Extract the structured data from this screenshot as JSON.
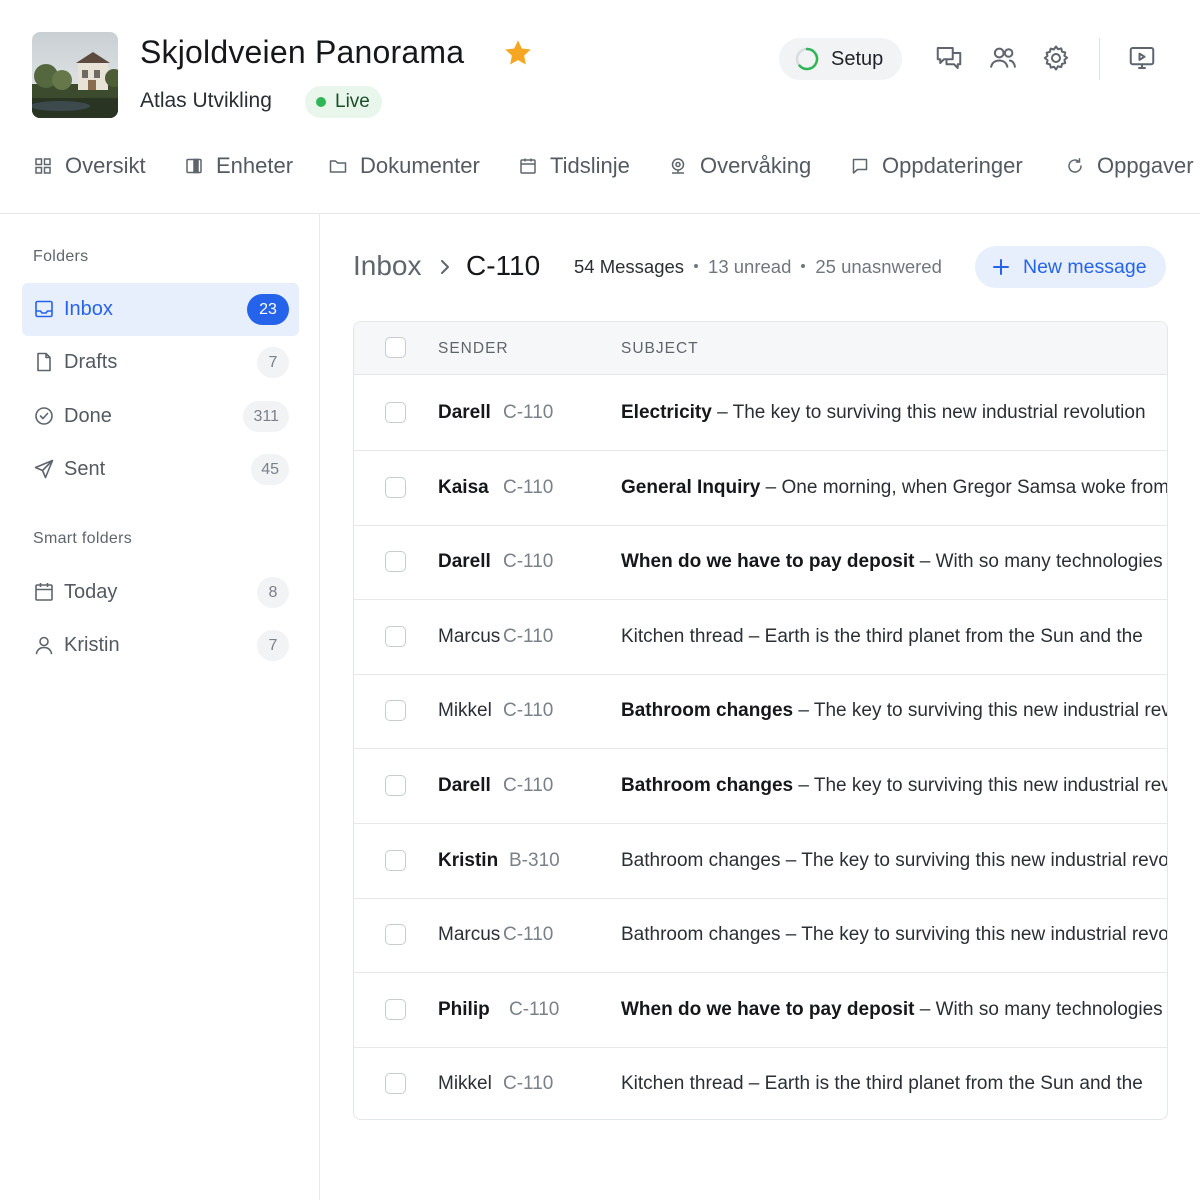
{
  "project": {
    "title": "Skjoldveien Panorama",
    "developer": "Atlas Utvikling",
    "status": "Live",
    "status_color": "#2fb757",
    "setup_label": "Setup"
  },
  "header_icons": [
    "chat-icon",
    "people-icon",
    "gear-icon",
    "presentation-icon"
  ],
  "tabs": [
    {
      "label": "Oversikt",
      "icon": "grid-icon"
    },
    {
      "label": "Enheter",
      "icon": "panel-icon"
    },
    {
      "label": "Dokumenter",
      "icon": "folder-icon"
    },
    {
      "label": "Tidslinje",
      "icon": "calendar-icon"
    },
    {
      "label": "Overvåking",
      "icon": "webcam-icon"
    },
    {
      "label": "Oppdateringer",
      "icon": "message-square-icon"
    },
    {
      "label": "Oppgaver",
      "icon": "refresh-icon"
    }
  ],
  "sidebar": {
    "folders_label": "Folders",
    "folders": [
      {
        "label": "Inbox",
        "count": "23",
        "icon": "inbox-icon",
        "active": true
      },
      {
        "label": "Drafts",
        "count": "7",
        "icon": "file-icon"
      },
      {
        "label": "Done",
        "count": "311",
        "icon": "check-circle-icon"
      },
      {
        "label": "Sent",
        "count": "45",
        "icon": "send-icon"
      }
    ],
    "smart_label": "Smart folders",
    "smart": [
      {
        "label": "Today",
        "count": "8",
        "icon": "calendar-icon"
      },
      {
        "label": "Kristin",
        "count": "7",
        "icon": "user-icon"
      }
    ]
  },
  "main": {
    "crumb_root": "Inbox",
    "crumb_current": "C-110",
    "messages": "54 Messages",
    "unread": "13 unread",
    "unanswered": "25 unasnwered",
    "new_message": "New message",
    "columns": {
      "sender": "SENDER",
      "subject": "SUBJECT"
    },
    "accent": "#2563eb"
  },
  "rows": [
    {
      "sender": "Darell",
      "unit": "C-110",
      "title": "Electricity",
      "body": "The key to surviving this new industrial revolution",
      "unread": true
    },
    {
      "sender": "Kaisa",
      "unit": "C-110",
      "title": "General Inquiry",
      "body": "One morning, when Gregor Samsa woke from",
      "unread": true
    },
    {
      "sender": "Darell",
      "unit": "C-110",
      "title": "When do we have to pay deposit",
      "body": "With so many technologies",
      "unread": true
    },
    {
      "sender": "Marcus",
      "unit": "C-110",
      "title": "Kitchen thread",
      "body": "Earth is the third planet from the Sun and the",
      "unread": false
    },
    {
      "sender": "Mikkel",
      "unit": "C-110",
      "title": "Bathroom changes",
      "body": "The key to surviving this new industrial revolution",
      "unread": false,
      "bold_subject": true
    },
    {
      "sender": "Darell",
      "unit": "C-110",
      "title": "Bathroom changes",
      "body": "The key to surviving this new industrial revolution",
      "unread": true
    },
    {
      "sender": "Kristin",
      "unit": "B-310",
      "title": "Bathroom changes",
      "body": "The key to surviving this new industrial revolution",
      "unread": true,
      "bold_subject": false
    },
    {
      "sender": "Marcus",
      "unit": "C-110",
      "title": "Bathroom changes",
      "body": "The key to surviving this new industrial revolution",
      "unread": false
    },
    {
      "sender": "Philip",
      "unit": "C-110",
      "title": "When do we have to pay deposit",
      "body": "With so many technologies",
      "unread": true
    },
    {
      "sender": "Mikkel",
      "unit": "C-110",
      "title": "Kitchen thread",
      "body": "Earth is the third planet from the Sun and the",
      "unread": false
    }
  ]
}
